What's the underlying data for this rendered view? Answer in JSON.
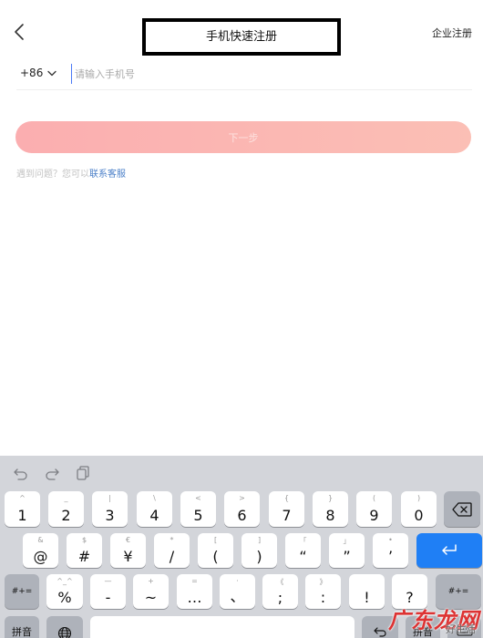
{
  "header": {
    "title": "手机快速注册",
    "enterprise_link": "企业注册"
  },
  "form": {
    "country_code": "+86",
    "phone_placeholder": "请输入手机号",
    "next_label": "下一步",
    "help_prefix": "遇到问题？您可以",
    "help_link": "联系客服"
  },
  "keyboard": {
    "row1": [
      {
        "sub": "^",
        "main": "1"
      },
      {
        "sub": "_",
        "main": "2"
      },
      {
        "sub": "|",
        "main": "3"
      },
      {
        "sub": "\\",
        "main": "4"
      },
      {
        "sub": "<",
        "main": "5"
      },
      {
        "sub": ">",
        "main": "6"
      },
      {
        "sub": "{",
        "main": "7"
      },
      {
        "sub": "}",
        "main": "8"
      },
      {
        "sub": "(",
        "main": "9"
      },
      {
        "sub": ")",
        "main": "0"
      }
    ],
    "row2": [
      {
        "sub": "&",
        "main": "@"
      },
      {
        "sub": "$",
        "main": "#"
      },
      {
        "sub": "€",
        "main": "¥"
      },
      {
        "sub": "*",
        "main": "/"
      },
      {
        "sub": "[",
        "main": "("
      },
      {
        "sub": "]",
        "main": ")"
      },
      {
        "sub": "「",
        "main": "“"
      },
      {
        "sub": "」",
        "main": "”"
      },
      {
        "sub": "•",
        "main": "’"
      }
    ],
    "row3": [
      {
        "sub": "^_^",
        "main": "%"
      },
      {
        "sub": "—",
        "main": "-"
      },
      {
        "sub": "+",
        "main": "~"
      },
      {
        "sub": "=",
        "main": "…"
      },
      {
        "sub": "·",
        "main": "、"
      },
      {
        "sub": "《",
        "main": ";"
      },
      {
        "sub": "》",
        "main": ":"
      },
      {
        "sub": "",
        "main": "!"
      },
      {
        "sub": "",
        "main": "?"
      }
    ],
    "shift_label": "#+=",
    "pinyin_label": "拼音",
    "pinyin_right_label": "拼音"
  },
  "watermark": {
    "text": "广东龙网",
    "sub": "好生活"
  },
  "colors": {
    "accent_blue": "#1f7ff5",
    "link_blue": "#4a7fc8",
    "button_pink": "#fbaeb0"
  }
}
